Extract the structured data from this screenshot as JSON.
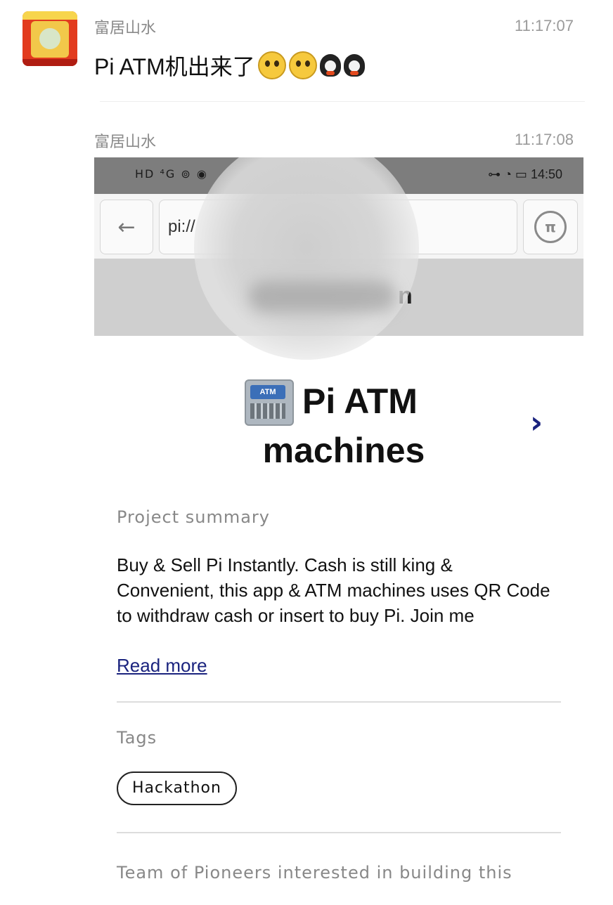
{
  "messages": [
    {
      "sender": "富居山水",
      "time": "11:17:07",
      "text": "Pi  ATM机出来了"
    },
    {
      "sender": "富居山水",
      "time": "11:17:08"
    }
  ],
  "screenshot": {
    "statusbar": {
      "left_icons": "HD ⁴G ⊚ ◉",
      "right": "⊶ ◔ ▭ 14:50"
    },
    "url": "pi://",
    "banner_text": "n",
    "app_title_line1": "Pi ATM",
    "app_title_line2": "machines",
    "atm_icon_label": "ATM",
    "pi_button_glyph": "π",
    "back_glyph": "←",
    "chevron_glyph": "›",
    "summary_label": "Project summary",
    "summary_text": "Buy & Sell Pi Instantly. Cash is still king & Convenient, this app & ATM machines uses QR Code to withdraw cash or insert to buy Pi. Join me",
    "read_more": "Read more",
    "tags_label": "Tags",
    "tags": [
      "Hackathon"
    ],
    "team_text": "Team of Pioneers interested in building this"
  }
}
